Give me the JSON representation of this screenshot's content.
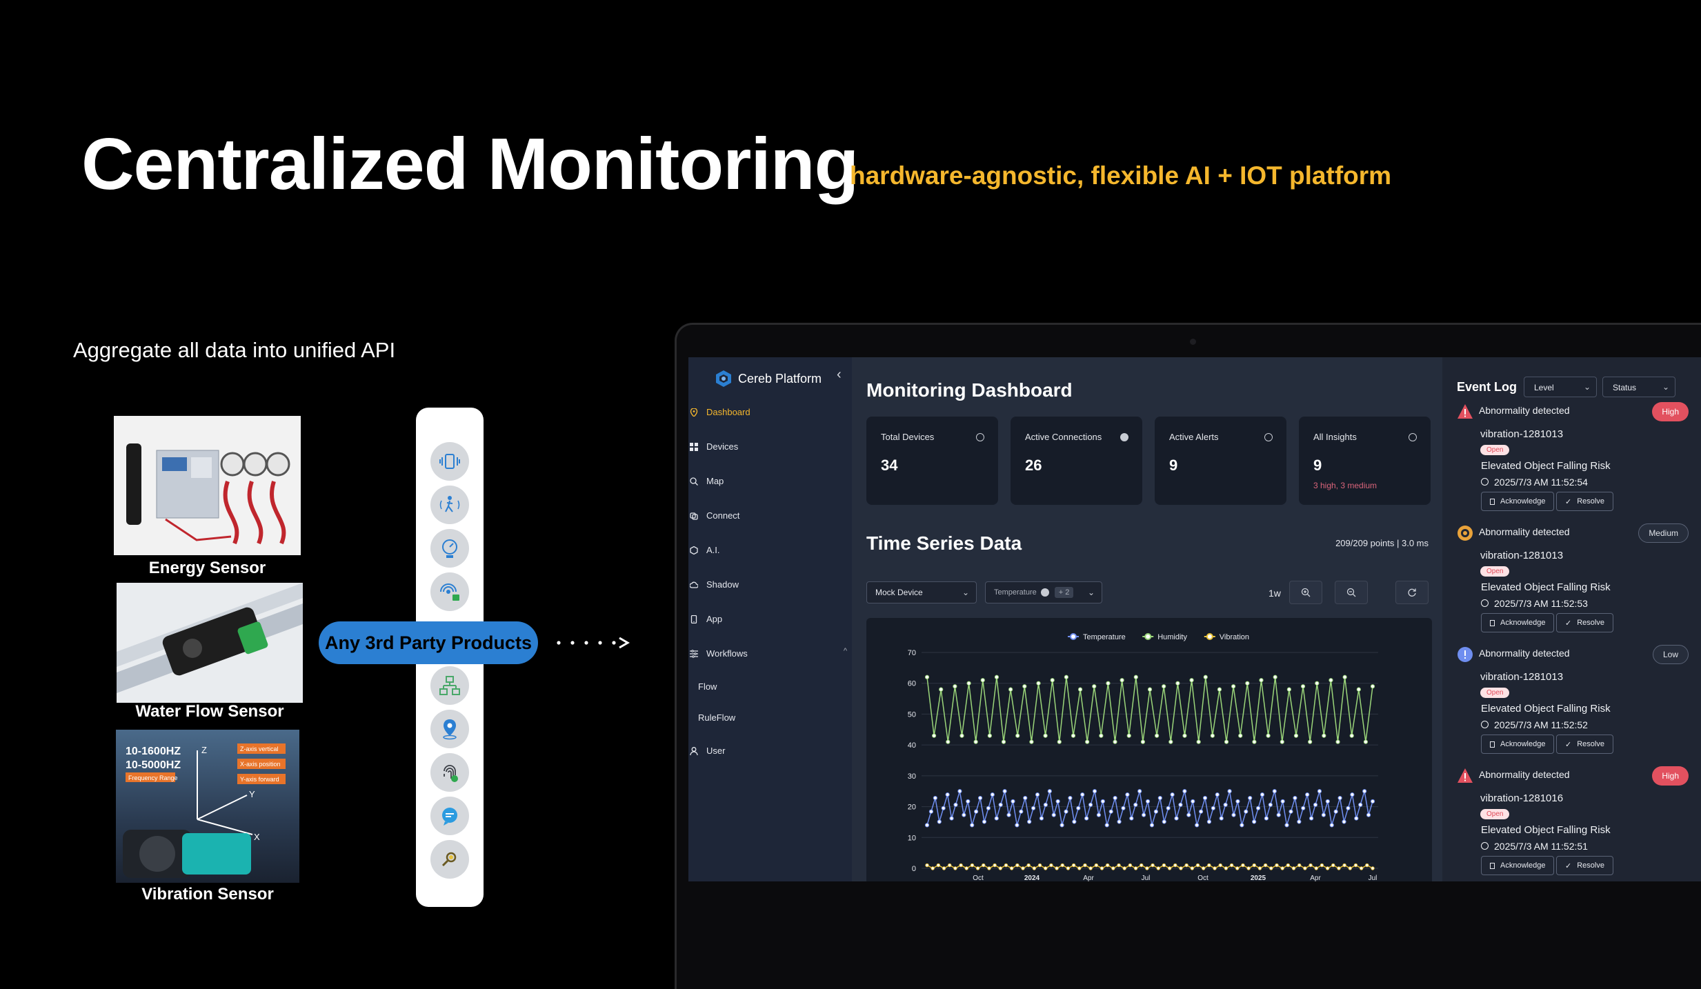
{
  "slide": {
    "title": "Centralized Monitoring",
    "subtitle": "hardware-agnostic, flexible AI + IOT platform",
    "aggregate_text": "Aggregate all data into unified API",
    "sensors": [
      {
        "label": "Energy Sensor"
      },
      {
        "label": "Water Flow Sensor"
      },
      {
        "label": "Vibration Sensor"
      }
    ],
    "vibration_photo_text": [
      "10-1600HZ",
      "10-5000HZ",
      "Frequency Range",
      "Z-axis vertical",
      "X-axis position",
      "Y-axis forward",
      "Z",
      "Y",
      "X"
    ],
    "third_party_label": "Any 3rd Party Products",
    "strip_icons": [
      "vibration-icon",
      "motion-icon",
      "gauge-icon",
      "wifi-lock-icon",
      "network-icon",
      "location-pin-icon",
      "fingerprint-icon",
      "chat-icon",
      "magnifier-icon"
    ]
  },
  "app": {
    "brand": "Cereb Platform",
    "collapse_glyph": "‹",
    "nav": [
      {
        "label": "Dashboard",
        "icon": "pin-icon",
        "active": true
      },
      {
        "label": "Devices",
        "icon": "grid-icon"
      },
      {
        "label": "Map",
        "icon": "map-icon"
      },
      {
        "label": "Connect",
        "icon": "connect-icon"
      },
      {
        "label": "A.I.",
        "icon": "chip-icon"
      },
      {
        "label": "Shadow",
        "icon": "cloud-icon"
      },
      {
        "label": "App",
        "icon": "phone-icon"
      },
      {
        "label": "Workflows",
        "icon": "workflow-icon"
      },
      {
        "label": "Flow"
      },
      {
        "label": "RuleFlow"
      },
      {
        "label": "User",
        "icon": "user-icon"
      }
    ],
    "workflows_caret": "^",
    "dashboard_title": "Monitoring Dashboard",
    "stats": [
      {
        "label": "Total Devices",
        "value": "34"
      },
      {
        "label": "Active Connections",
        "value": "26"
      },
      {
        "label": "Active Alerts",
        "value": "9"
      },
      {
        "label": "All Insights",
        "value": "9",
        "sub": "3 high, 3 medium"
      }
    ],
    "timeseries_title": "Time Series Data",
    "points_info": "209/209 points | 3.0 ms",
    "device_select": "Mock Device",
    "metric_select": "Temperature",
    "metric_extra": "+ 2",
    "range_label": "1w",
    "event_log": {
      "title": "Event Log",
      "level_select": "Level",
      "status_select": "Status",
      "acknowledge": "Acknowledge",
      "resolve": "Resolve",
      "events": [
        {
          "title": "Abnormality detected",
          "level": "High",
          "device": "vibration-1281013",
          "status": "Open",
          "risk": "Elevated Object Falling Risk",
          "time": "2025/7/3 AM 11:52:54"
        },
        {
          "title": "Abnormality detected",
          "level": "Medium",
          "device": "vibration-1281013",
          "status": "Open",
          "risk": "Elevated Object Falling Risk",
          "time": "2025/7/3 AM 11:52:53"
        },
        {
          "title": "Abnormality detected",
          "level": "Low",
          "device": "vibration-1281013",
          "status": "Open",
          "risk": "Elevated Object Falling Risk",
          "time": "2025/7/3 AM 11:52:52"
        },
        {
          "title": "Abnormality detected",
          "level": "High",
          "device": "vibration-1281016",
          "status": "Open",
          "risk": "Elevated Object Falling Risk",
          "time": "2025/7/3 AM 11:52:51"
        }
      ]
    }
  },
  "colors": {
    "accent": "#f5b72d",
    "pill": "#2b7fd2",
    "temperature": "#6f8ef0",
    "humidity": "#9bd67a",
    "vibration": "#e8c23a",
    "high": "#e2515f",
    "open": "#e14b5a"
  },
  "chart_data": {
    "type": "line",
    "legend": [
      "Temperature",
      "Humidity",
      "Vibration"
    ],
    "legend_position": "top",
    "y_ticks": [
      0,
      10,
      20,
      30,
      40,
      50,
      60,
      70
    ],
    "ylim": [
      0,
      70
    ],
    "x_tick_labels": [
      "Oct",
      "2024",
      "Apr",
      "Jul",
      "Oct",
      "2025",
      "Apr",
      "Jul"
    ],
    "grid": true,
    "series": [
      {
        "name": "Temperature",
        "range": [
          14,
          25
        ],
        "points": 110
      },
      {
        "name": "Humidity",
        "range": [
          40,
          62
        ],
        "points": 65
      },
      {
        "name": "Vibration",
        "range": [
          0,
          1
        ],
        "points": 80
      }
    ]
  }
}
